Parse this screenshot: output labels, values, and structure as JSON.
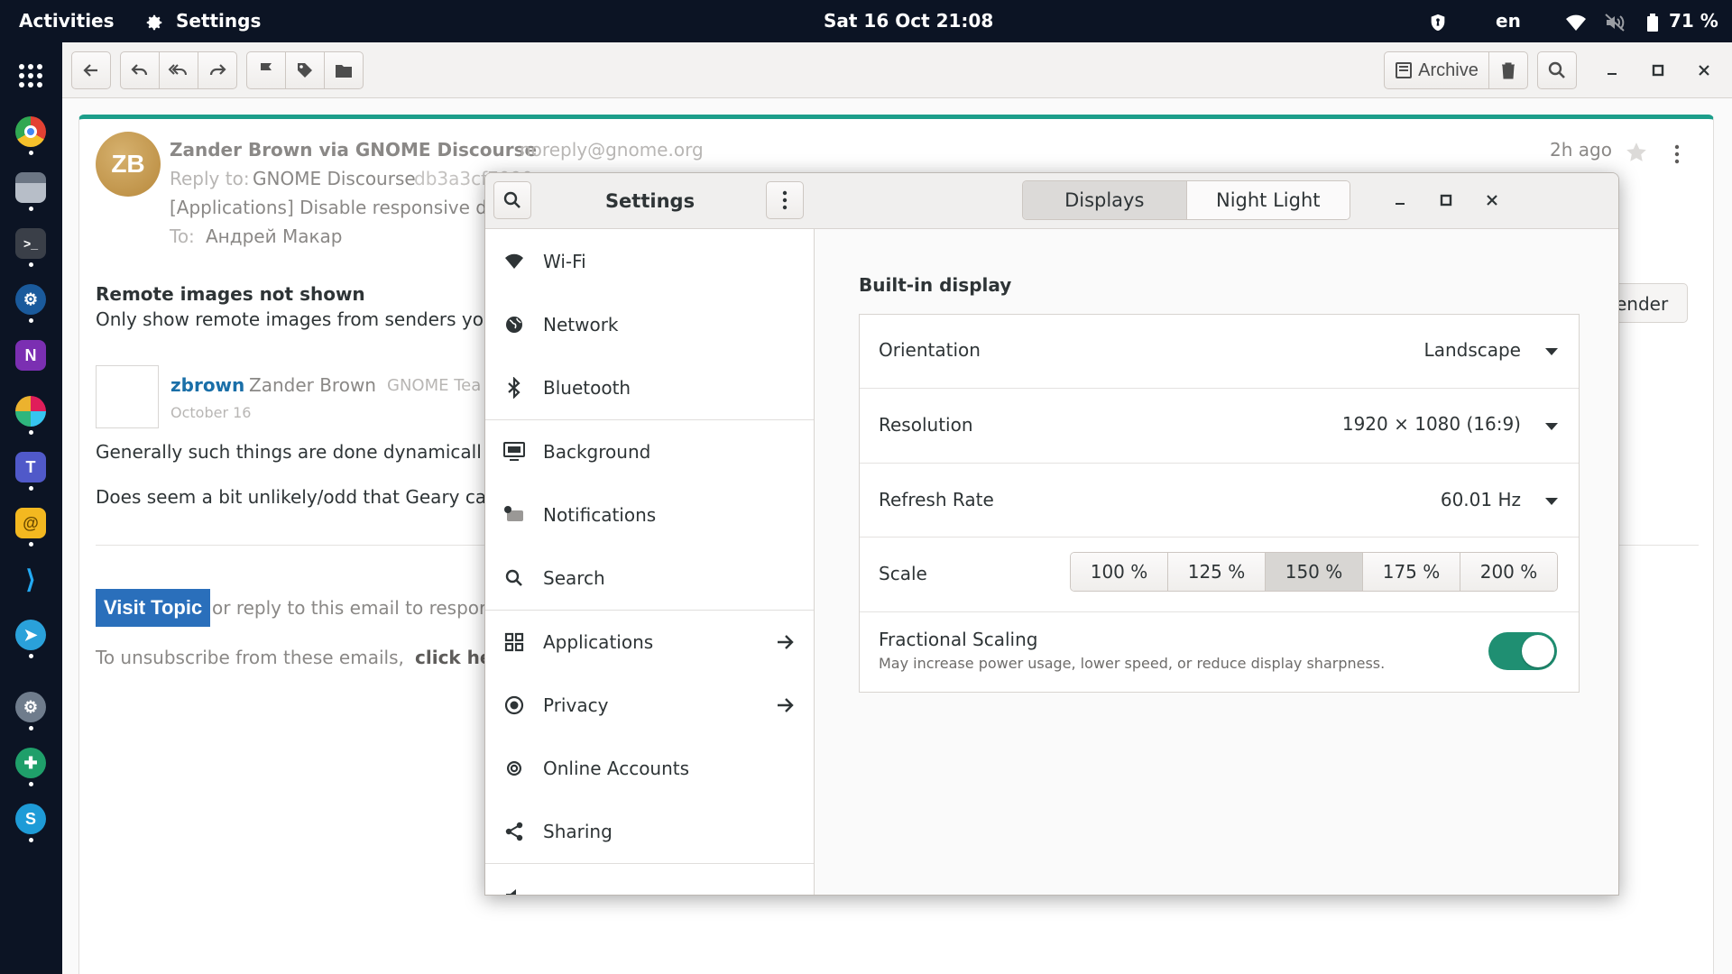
{
  "topbar": {
    "activities": "Activities",
    "app_menu": "Settings",
    "clock": "Sat 16 Oct  21:08",
    "language": "en",
    "battery": "71 %"
  },
  "dock": {
    "apps": [
      "google-chrome",
      "files",
      "terminal",
      "steam",
      "onenote",
      "slack",
      "teams",
      "mail",
      "vscode",
      "telegram",
      "settings",
      "gnome-extensions",
      "skype"
    ]
  },
  "geary": {
    "archive_label": "Archive",
    "sender_name": "Zander Brown via GNOME Discourse",
    "sender_email": "noreply@gnome.org",
    "avatar_initials": "ZB",
    "time_ago": "2h ago",
    "reply_to_label": "Reply to:",
    "reply_to_value": "GNOME Discourse",
    "reply_to_address": "db3a3cf7090",
    "subject": "[Applications] Disable responsive desig",
    "to_label": "To:",
    "to_value": "Андрей Макар",
    "remote_images_title": "Remote images not shown",
    "remote_images_text": "Only show remote images from senders you tr",
    "sender_button": "ender",
    "post_username": "zbrown",
    "post_fullname": "Zander Brown",
    "post_group": "GNOME Tea",
    "post_date": "October 16",
    "body_line1": "Generally such things are done dynamicall",
    "body_line2": "Does seem a bit unlikely/odd that Geary ca",
    "visit_topic": "Visit Topic",
    "reply_text": "or reply to this email to respor",
    "unsubscribe_text": "To unsubscribe from these emails,",
    "unsubscribe_link": "click he"
  },
  "settings": {
    "title": "Settings",
    "sidebar": [
      {
        "label": "Wi-Fi",
        "icon": "wifi-icon"
      },
      {
        "label": "Network",
        "icon": "network-icon"
      },
      {
        "label": "Bluetooth",
        "icon": "bluetooth-icon"
      },
      {
        "label": "Background",
        "icon": "background-icon"
      },
      {
        "label": "Notifications",
        "icon": "notifications-icon"
      },
      {
        "label": "Search",
        "icon": "search-icon"
      },
      {
        "label": "Applications",
        "icon": "applications-icon"
      },
      {
        "label": "Privacy",
        "icon": "privacy-icon"
      },
      {
        "label": "Online Accounts",
        "icon": "online-accounts-icon"
      },
      {
        "label": "Sharing",
        "icon": "sharing-icon"
      }
    ],
    "tabs": [
      "Displays",
      "Night Light"
    ],
    "active_tab": "Displays",
    "section_title": "Built-in display",
    "orientation_label": "Orientation",
    "orientation_value": "Landscape",
    "resolution_label": "Resolution",
    "resolution_value": "1920 × 1080 (16:9)",
    "refresh_label": "Refresh Rate",
    "refresh_value": "60.01 Hz",
    "scale_label": "Scale",
    "scale_options": [
      "100 %",
      "125 %",
      "150 %",
      "175 %",
      "200 %"
    ],
    "scale_selected": "150 %",
    "fractional_label": "Fractional Scaling",
    "fractional_desc": "May increase power usage, lower speed, or reduce display sharpness.",
    "fractional_enabled": true,
    "accent": "#1f8f72"
  }
}
